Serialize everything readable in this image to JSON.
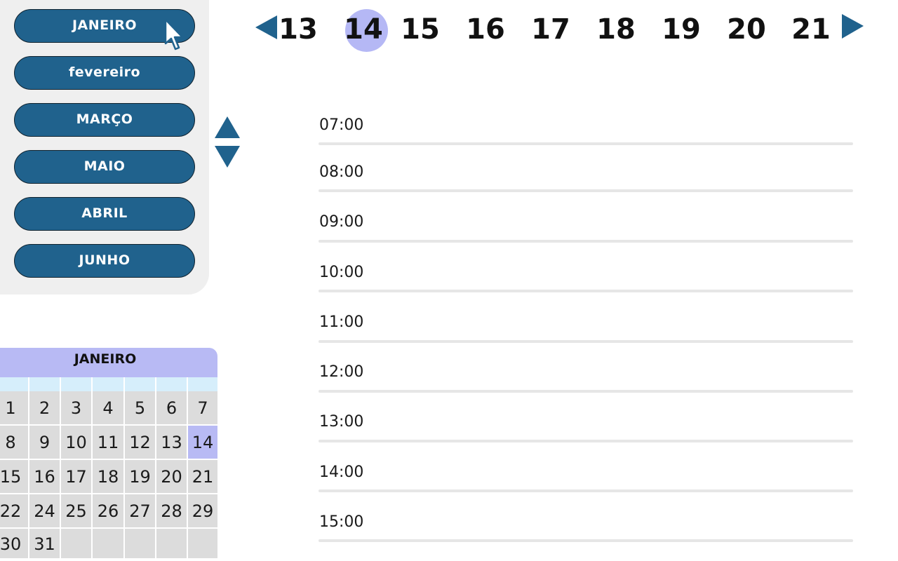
{
  "months": {
    "items": [
      {
        "label": "JANEIRO"
      },
      {
        "label": "fevereiro"
      },
      {
        "label": "MARÇO"
      },
      {
        "label": "MAIO"
      },
      {
        "label": "ABRIL"
      },
      {
        "label": "JUNHO"
      }
    ]
  },
  "days": {
    "items": [
      "13",
      "14",
      "15",
      "16",
      "17",
      "18",
      "19",
      "20",
      "21"
    ],
    "selected": "14"
  },
  "schedule": {
    "times": [
      "07:00",
      "08:00",
      "09:00",
      "10:00",
      "11:00",
      "12:00",
      "13:00",
      "14:00",
      "15:00"
    ]
  },
  "calendar": {
    "month": "JANEIRO",
    "selected": "14",
    "weeks": [
      [
        "1",
        "2",
        "3",
        "4",
        "5",
        "6",
        "7"
      ],
      [
        "8",
        "9",
        "10",
        "11",
        "12",
        "13",
        "14"
      ],
      [
        "15",
        "16",
        "17",
        "18",
        "19",
        "20",
        "21"
      ],
      [
        "22",
        "24",
        "25",
        "26",
        "27",
        "28",
        "29"
      ],
      [
        "30",
        "31",
        "",
        "",
        "",
        "",
        ""
      ]
    ]
  },
  "colors": {
    "month_button": "#20628d",
    "accent_lilac": "#b8baf4",
    "nav_arrow": "#20628d",
    "calendar_weekday_row": "#d6eefb",
    "calendar_cell": "#dcdcdc"
  },
  "icons": {
    "cursor": "mouse-pointer-icon",
    "prev_day": "triangle-left-icon",
    "next_day": "triangle-right-icon",
    "scroll_up": "triangle-up-icon",
    "scroll_down": "triangle-down-icon"
  }
}
